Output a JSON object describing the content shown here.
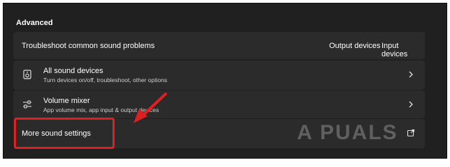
{
  "section": {
    "title": "Advanced"
  },
  "troubleshoot": {
    "label": "Troubleshoot common sound problems",
    "output_devices": "Output devices",
    "input_devices": "Input devices"
  },
  "all_sound_devices": {
    "title": "All sound devices",
    "subtitle": "Turn devices on/off, troubleshoot, other options"
  },
  "volume_mixer": {
    "title": "Volume mixer",
    "subtitle": "App volume mix, app input & output devices"
  },
  "more_sound_settings": {
    "label": "More sound settings"
  },
  "watermark": {
    "brand": "A PUALS"
  },
  "colors": {
    "highlight": "#e02020",
    "background": "#202020",
    "card": "#2b2b2b"
  }
}
